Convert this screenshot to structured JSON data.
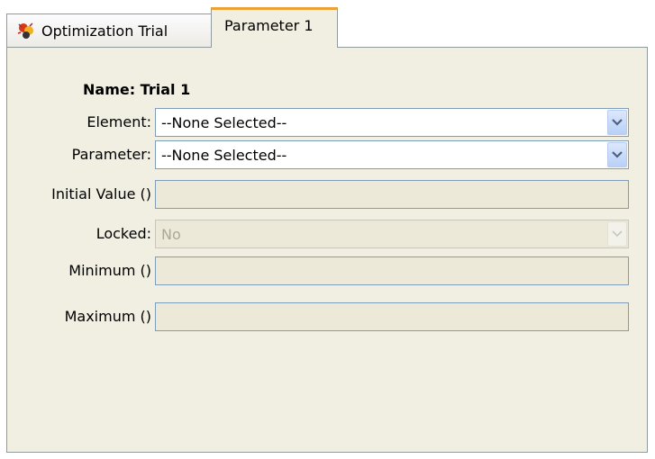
{
  "tabs": [
    {
      "label": "Optimization Trial",
      "icon": "optimization-trial-icon",
      "active": false
    },
    {
      "label": "Parameter 1",
      "active": true
    }
  ],
  "form": {
    "name_label": "Name: Trial 1",
    "element": {
      "label": "Element:",
      "value": "--None Selected--"
    },
    "parameter": {
      "label": "Parameter:",
      "value": "--None Selected--"
    },
    "initial_value": {
      "label": "Initial Value ()",
      "value": ""
    },
    "locked": {
      "label": "Locked:",
      "value": "No"
    },
    "minimum": {
      "label": "Minimum ()",
      "value": ""
    },
    "maximum": {
      "label": "Maximum ()",
      "value": ""
    }
  },
  "colors": {
    "active_tab_accent": "#f0a030",
    "panel_background": "#f1efe2",
    "field_border": "#7f9db9",
    "dropdown_arrow": "#4d6185"
  }
}
